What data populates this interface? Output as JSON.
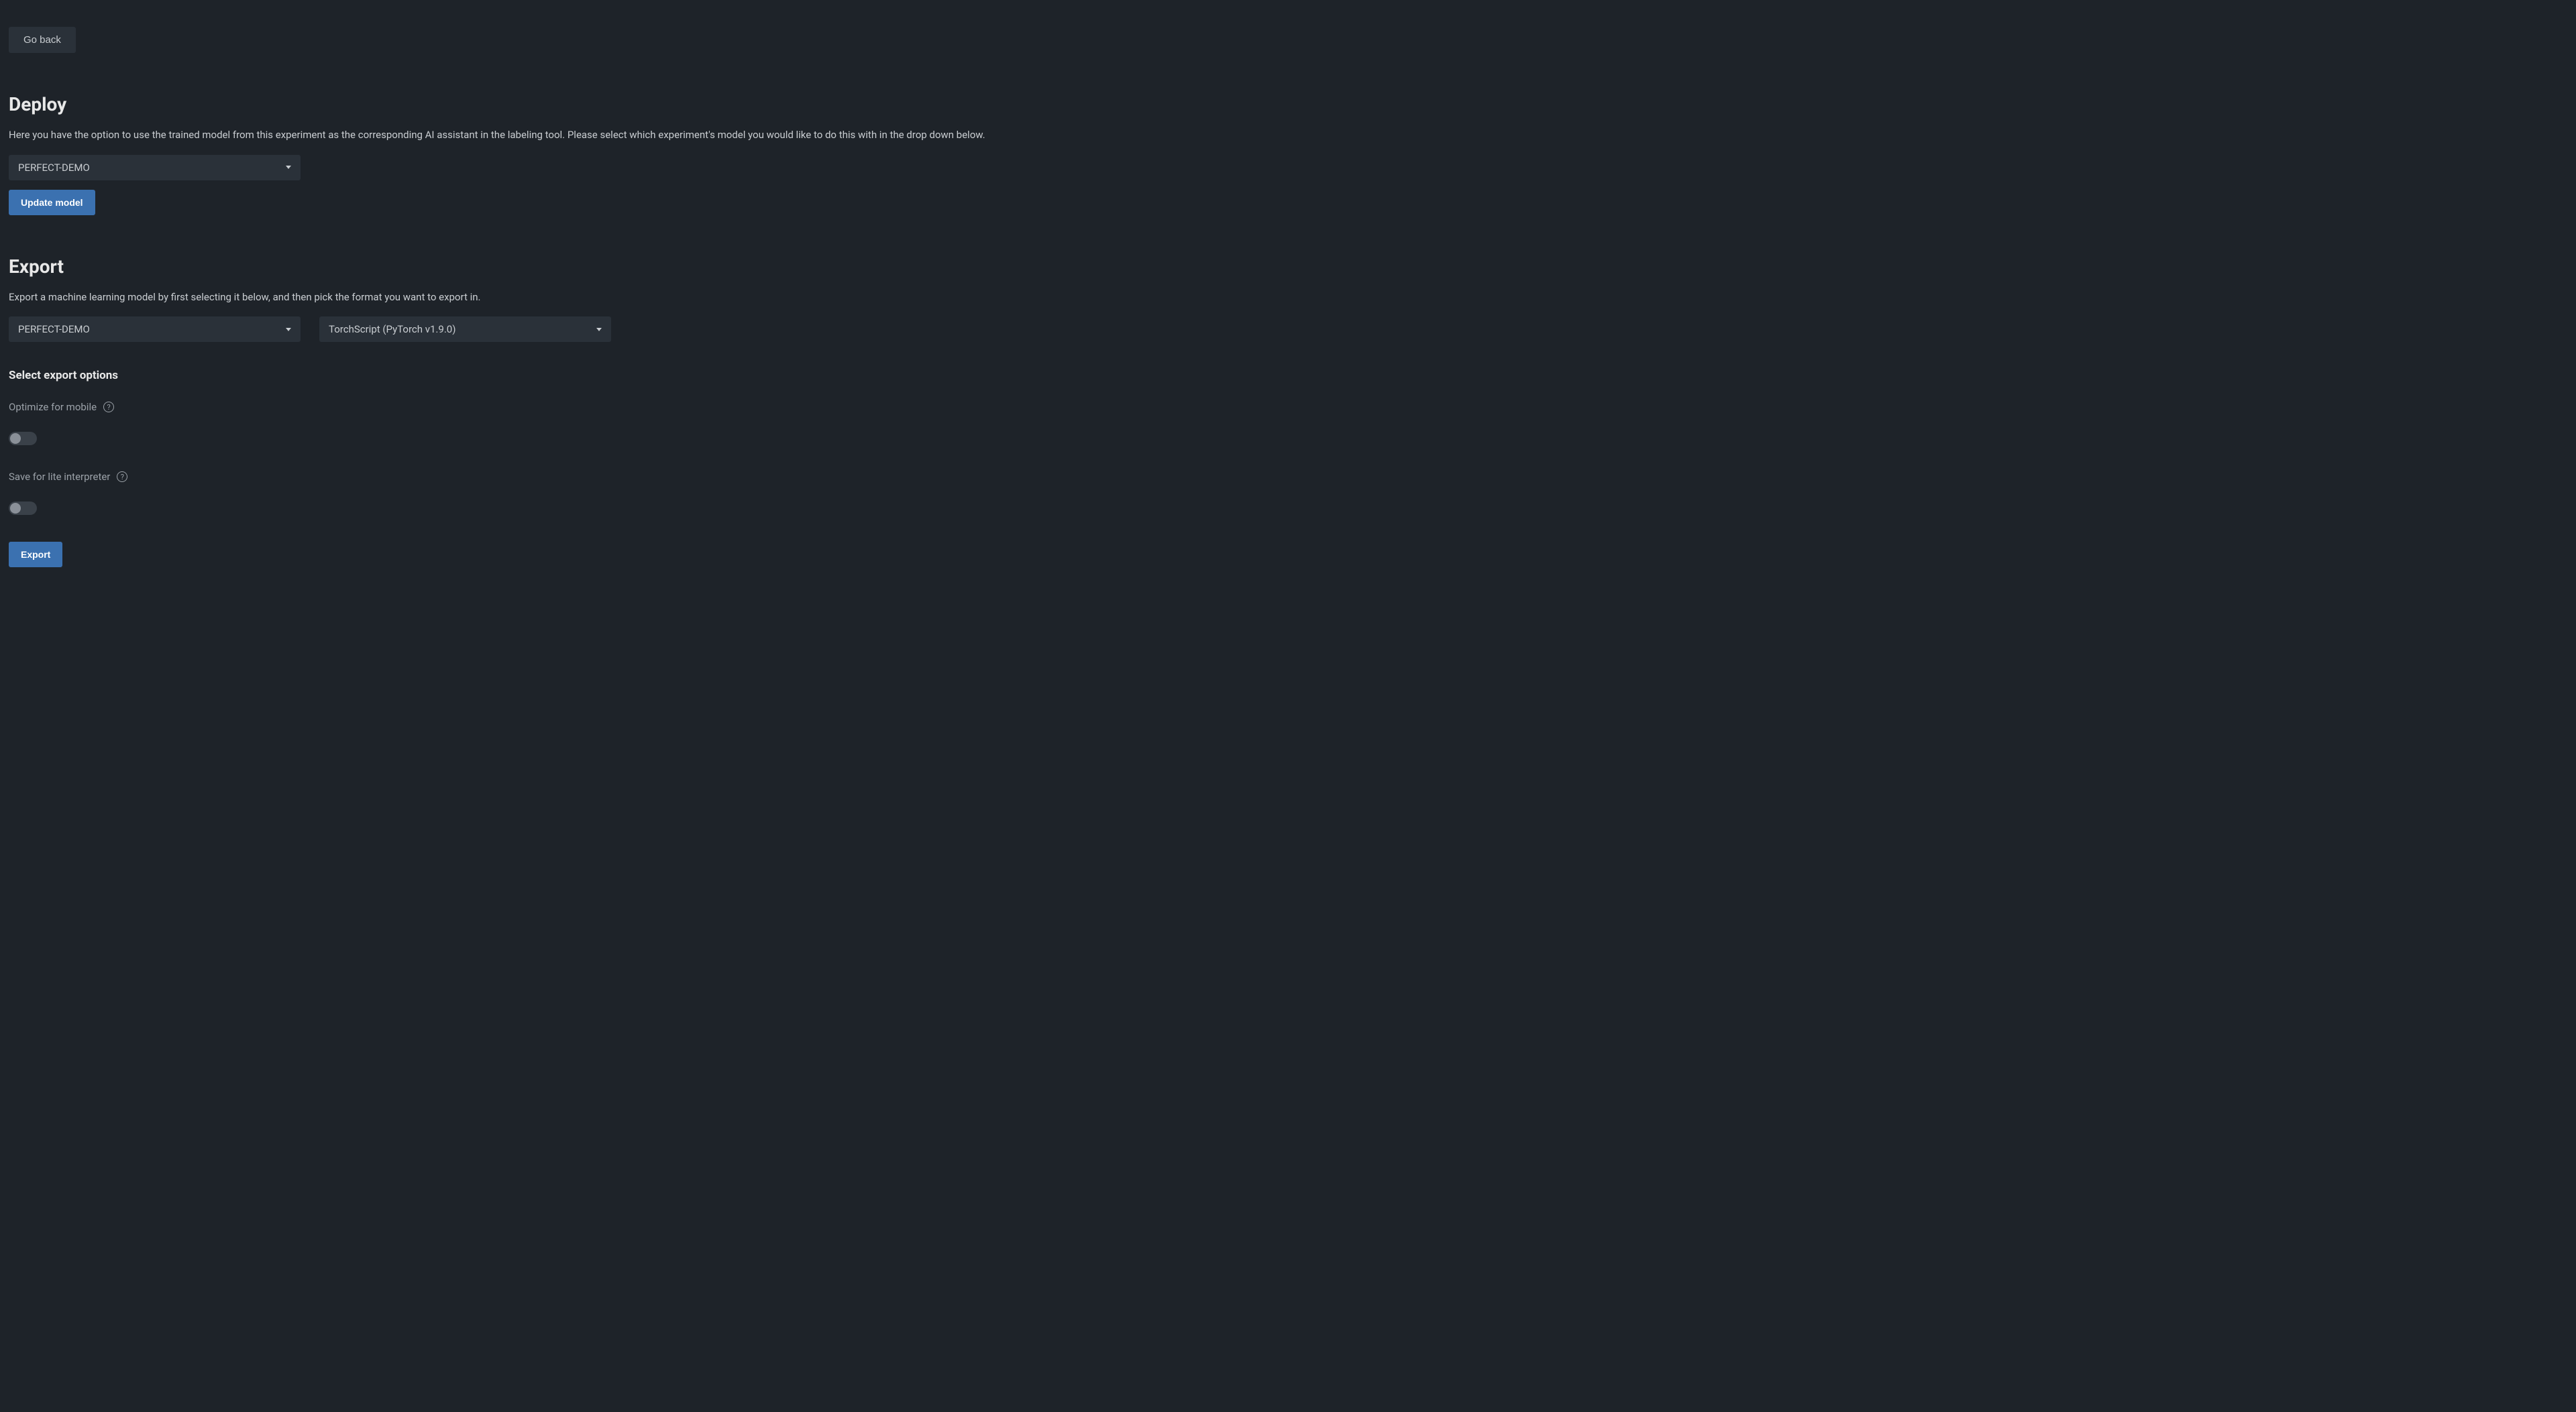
{
  "nav": {
    "go_back": "Go back"
  },
  "deploy": {
    "title": "Deploy",
    "description": "Here you have the option to use the trained model from this experiment as the corresponding AI assistant in the labeling tool. Please select which experiment's model you would like to do this with in the drop down below.",
    "dropdown_value": "PERFECT-DEMO",
    "button_label": "Update model"
  },
  "export": {
    "title": "Export",
    "description": "Export a machine learning model by first selecting it below, and then pick the format you want to export in.",
    "model_dropdown_value": "PERFECT-DEMO",
    "format_dropdown_value": "TorchScript (PyTorch v1.9.0)",
    "options_title": "Select export options",
    "option1_label": "Optimize for mobile",
    "option2_label": "Save for lite interpreter",
    "button_label": "Export"
  }
}
